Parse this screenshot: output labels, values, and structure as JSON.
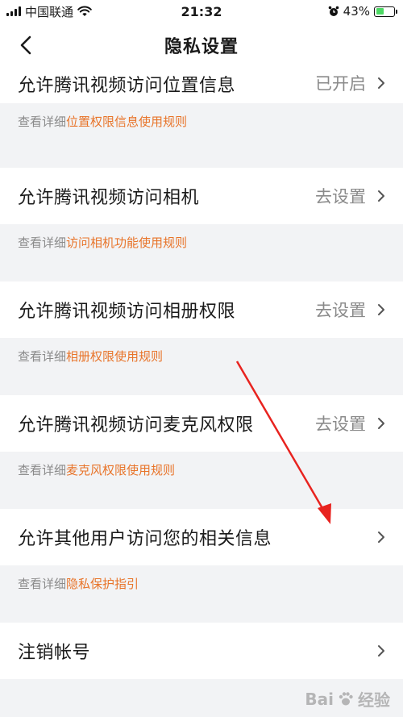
{
  "status_bar": {
    "carrier": "中国联通",
    "time": "21:32",
    "battery_percent": "43%",
    "battery_level": 0.43
  },
  "nav": {
    "title": "隐私设置"
  },
  "settings": [
    {
      "label": "允许腾讯视频访问位置信息",
      "value": "已开启",
      "hint_prefix": "查看详细",
      "hint_link": "位置权限信息使用规则"
    },
    {
      "label": "允许腾讯视频访问相机",
      "value": "去设置",
      "hint_prefix": "查看详细",
      "hint_link": "访问相机功能使用规则"
    },
    {
      "label": "允许腾讯视频访问相册权限",
      "value": "去设置",
      "hint_prefix": "查看详细",
      "hint_link": "相册权限使用规则"
    },
    {
      "label": "允许腾讯视频访问麦克风权限",
      "value": "去设置",
      "hint_prefix": "查看详细",
      "hint_link": "麦克风权限使用规则"
    },
    {
      "label": "允许其他用户访问您的相关信息",
      "value": "",
      "hint_prefix": "查看详细",
      "hint_link": "隐私保护指引"
    },
    {
      "label": "注销帐号",
      "value": ""
    }
  ],
  "colors": {
    "link": "#e8742a",
    "arrow": "#e8231f"
  },
  "watermark": {
    "text": "Bai",
    "suffix": "经验"
  }
}
